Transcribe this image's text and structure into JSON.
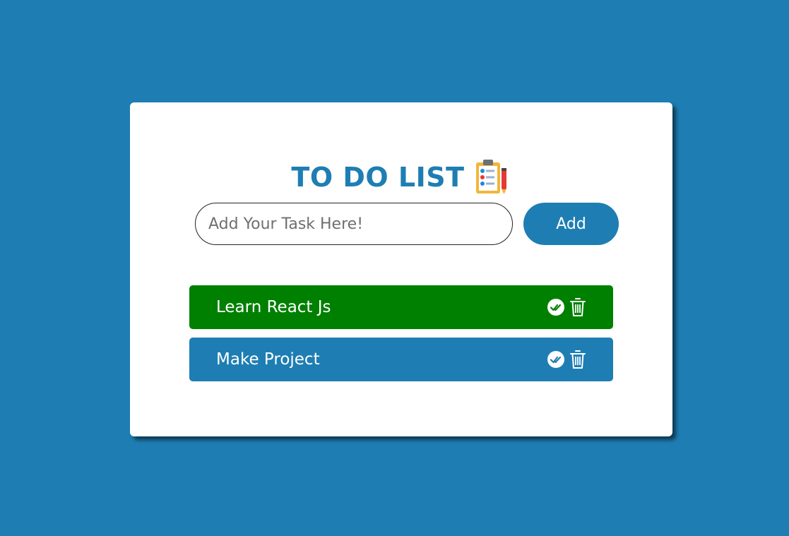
{
  "header": {
    "title": "TO DO LIST",
    "title_icon": "clipboard-checklist-icon"
  },
  "task_input": {
    "value": "",
    "placeholder": "Add Your Task Here!"
  },
  "add_button": {
    "label": "Add"
  },
  "tasks": [
    {
      "label": "Learn React Js",
      "completed": true,
      "background_color": "#008000",
      "icons": [
        "check-circle-icon",
        "trash-icon"
      ]
    },
    {
      "label": "Make Project",
      "completed": false,
      "background_color": "#1e7eb3",
      "icons": [
        "check-circle-icon",
        "trash-icon"
      ]
    }
  ],
  "colors": {
    "page_background": "#1e7eb3",
    "accent": "#1e7eb3",
    "completed": "#008000",
    "card_background": "#ffffff"
  }
}
